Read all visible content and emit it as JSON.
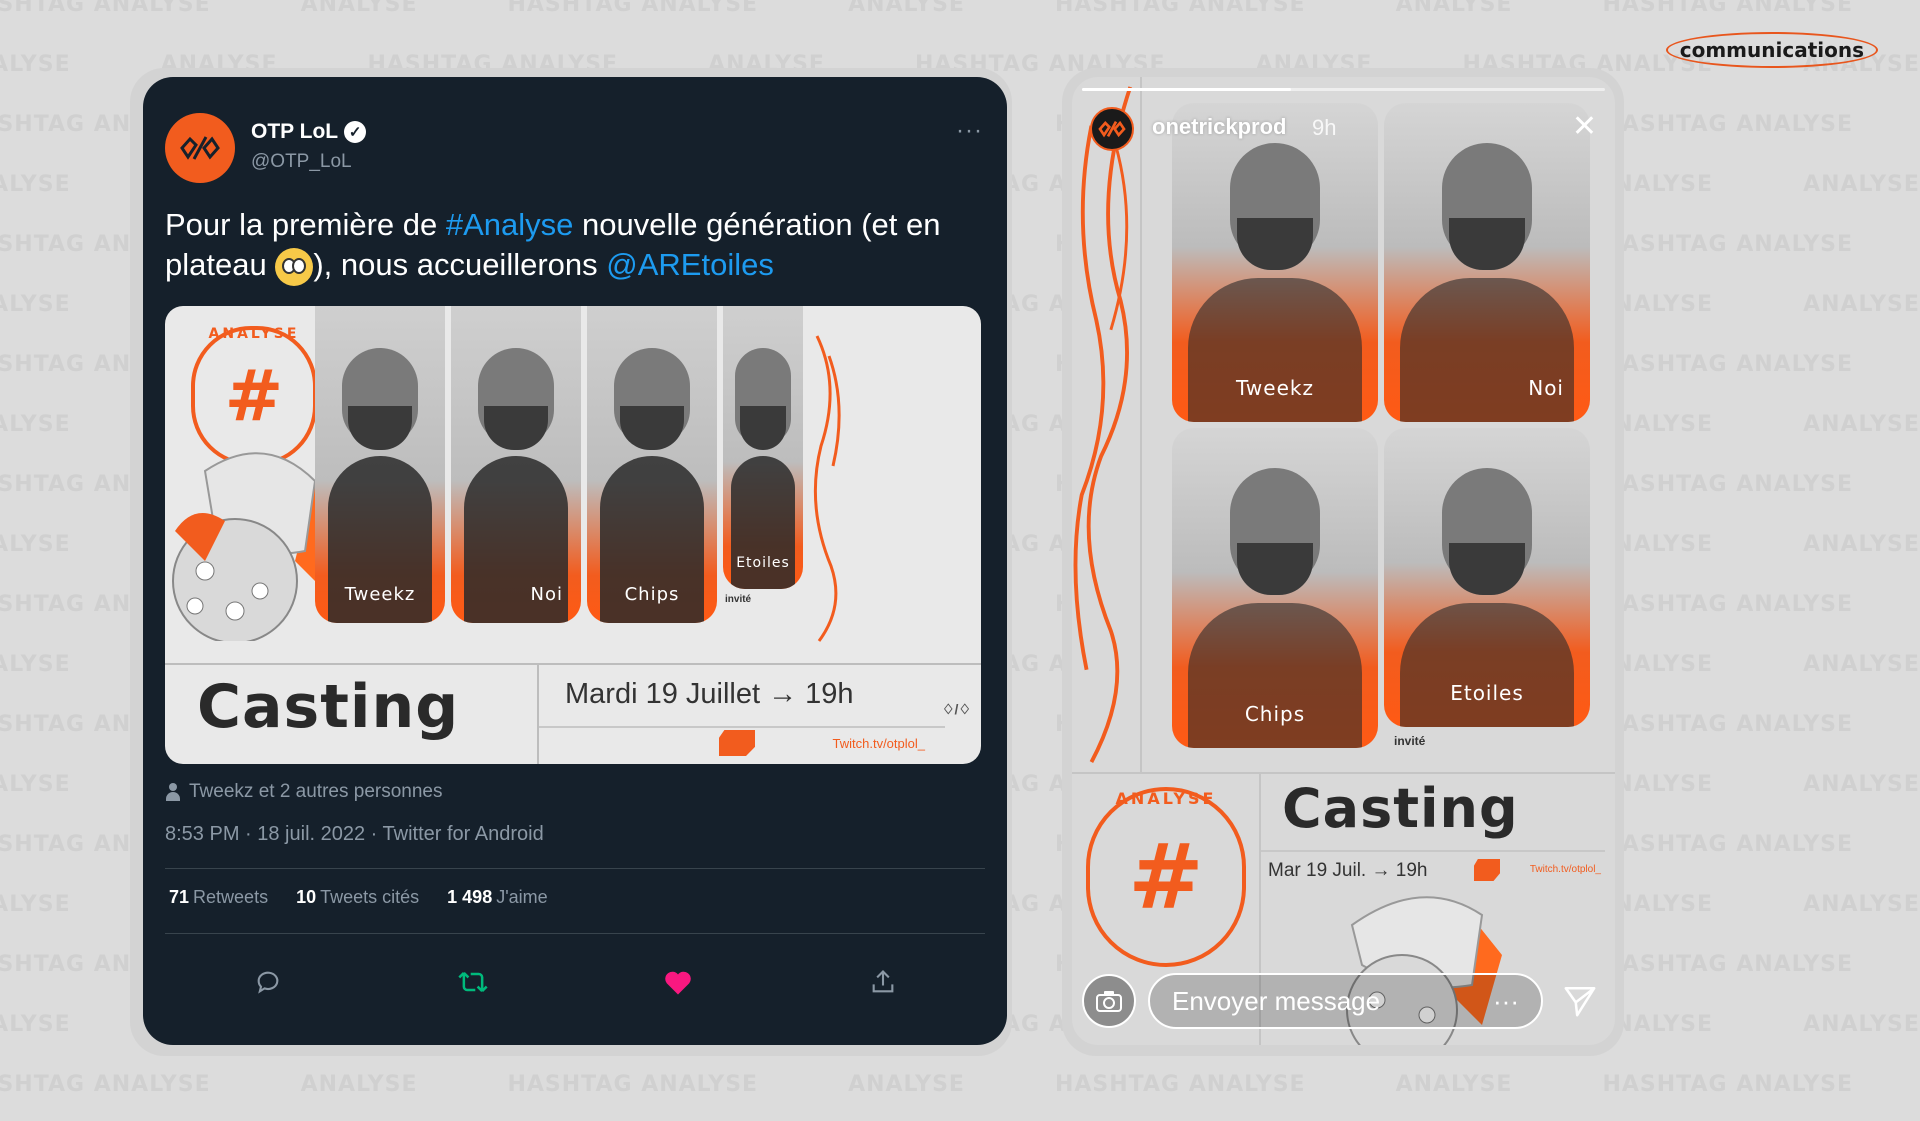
{
  "background": {
    "watermark_text": "HASHTAG ANALYSE",
    "watermark_text_short": "ANALYSE",
    "brand_tag": "communications"
  },
  "colors": {
    "brand_orange": "#f25c1e",
    "tweet_bg": "#15202b",
    "link": "#1d9bf0",
    "retweet_green": "#00ba7c",
    "like_pink": "#f91880"
  },
  "tweet": {
    "display_name": "OTP LoL",
    "verified_mark": "✓",
    "handle": "@OTP_LoL",
    "more": "···",
    "text": {
      "part1": "Pour la première de ",
      "hashtag": "#Analyse",
      "part2": " nouvelle génération (et en plateau ",
      "part3": "), nous accueillerons ",
      "mention": "@AREtoiles"
    },
    "media": {
      "emblem_label": "ANALYSE",
      "emblem_symbol": "#",
      "players": [
        "Tweekz",
        "Noi",
        "Chips",
        "Etoiles"
      ],
      "invite_label": "invité",
      "casting_title": "Casting",
      "casting_date": "Mardi 19 Juillet  →  19h",
      "twitch_url": "Twitch.tv/otplol_",
      "corner_logo": "♢/♢"
    },
    "liked_by": "Tweekz et 2 autres personnes",
    "meta": "8:53 PM · 18 juil. 2022 · Twitter for Android",
    "stats": {
      "retweets_count": "71",
      "retweets_label": "Retweets",
      "quotes_count": "10",
      "quotes_label": "Tweets cités",
      "likes_count": "1 498",
      "likes_label": "J'aime"
    },
    "actions": [
      "reply-icon",
      "retweet-icon",
      "like-icon",
      "share-icon"
    ]
  },
  "story": {
    "progress": 0.4,
    "username": "onetrickprod",
    "time": "9h",
    "close": "✕",
    "players": [
      "Tweekz",
      "Noi",
      "Chips",
      "Etoiles"
    ],
    "invite_label": "invité",
    "emblem_label": "ANALYSE",
    "emblem_symbol": "#",
    "casting_title": "Casting",
    "casting_date": "Mar 19 Juil. → 19h",
    "twitch_url": "Twitch.tv/otplol_",
    "message_placeholder": "Envoyer message",
    "message_more": "···"
  }
}
